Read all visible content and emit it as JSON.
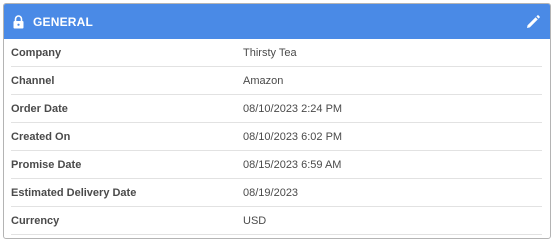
{
  "panel": {
    "title": "GENERAL",
    "header_color": "#4a8ae6",
    "header_icon": "lock-icon",
    "action_icon": "pencil-icon"
  },
  "fields": [
    {
      "label": "Company",
      "value": "Thirsty Tea"
    },
    {
      "label": "Channel",
      "value": "Amazon"
    },
    {
      "label": "Order Date",
      "value": "08/10/2023 2:24 PM"
    },
    {
      "label": "Created On",
      "value": "08/10/2023 6:02 PM"
    },
    {
      "label": "Promise Date",
      "value": "08/15/2023 6:59 AM"
    },
    {
      "label": "Estimated Delivery Date",
      "value": "08/19/2023"
    },
    {
      "label": "Currency",
      "value": "USD"
    }
  ]
}
